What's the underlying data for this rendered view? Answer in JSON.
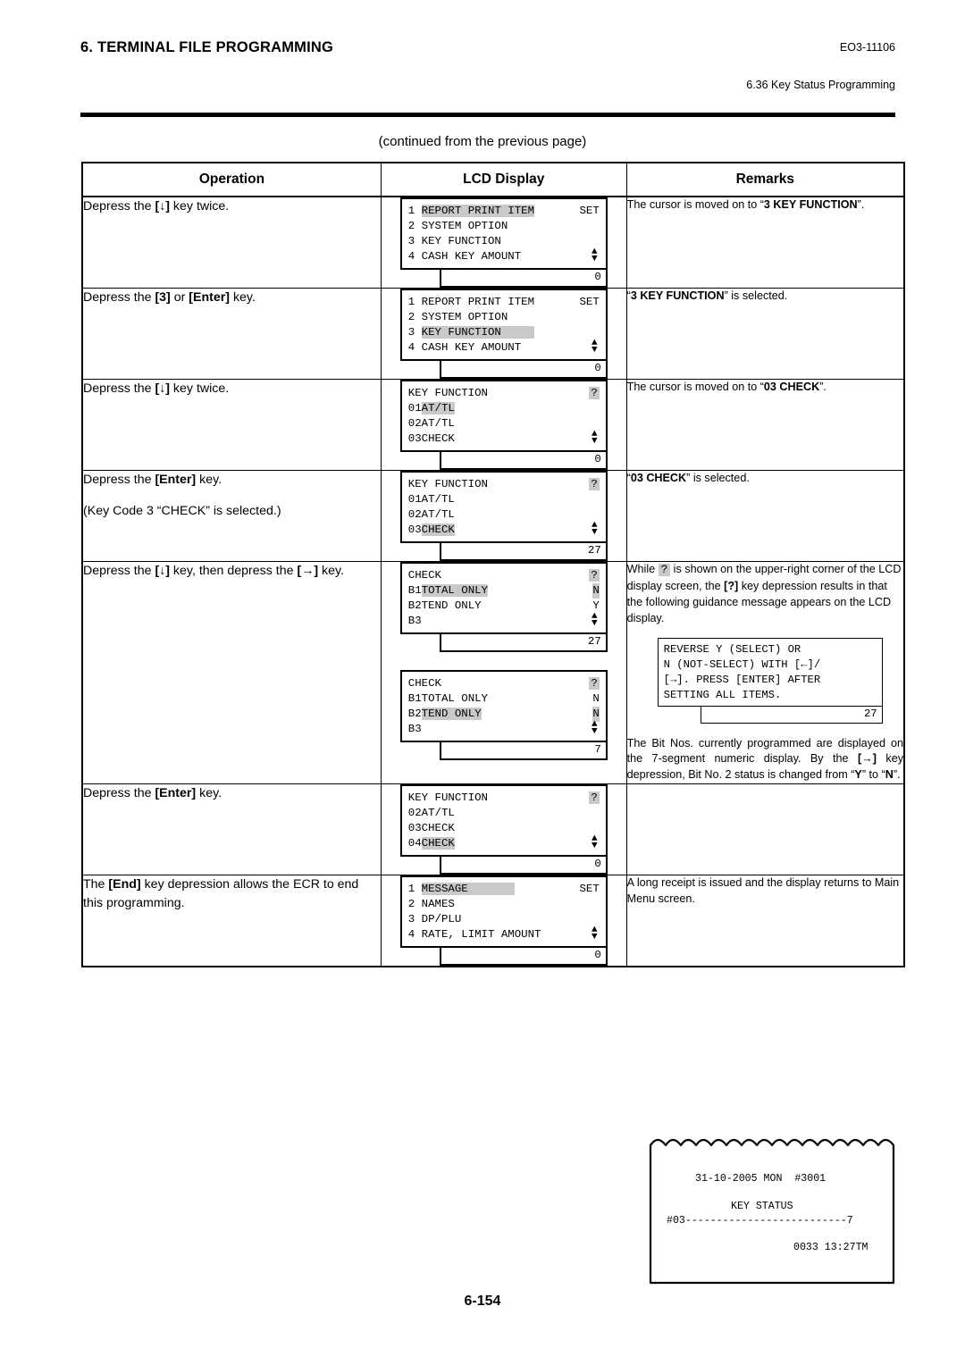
{
  "header": {
    "title": "6. TERMINAL FILE PROGRAMMING",
    "doc_code": "EO3-11106",
    "section": "6.36 Key Status Programming"
  },
  "continued_note": "(continued from the previous page)",
  "table": {
    "columns": [
      "Operation",
      "LCD Display",
      "Remarks"
    ],
    "rows": [
      {
        "operation_lines": [
          "Depress the [↓] key twice."
        ],
        "displays": [
          {
            "lines": [
              {
                "prefix": "1 ",
                "text": "REPORT PRINT ITEM",
                "highlight": true,
                "right": "SET"
              },
              {
                "prefix": "2 ",
                "text": "SYSTEM OPTION",
                "highlight": false
              },
              {
                "prefix": "3 ",
                "text": "KEY FUNCTION",
                "highlight": false
              },
              {
                "prefix": "4 ",
                "text": "CASH KEY AMOUNT",
                "highlight": false,
                "arrows": true
              }
            ],
            "numeric": "0"
          }
        ],
        "remarks": [
          "The cursor is moved on to “3 KEY FUNCTION”."
        ]
      },
      {
        "operation_lines": [
          "Depress the [3] or [Enter] key."
        ],
        "displays": [
          {
            "lines": [
              {
                "prefix": "1 ",
                "text": "REPORT PRINT ITEM",
                "highlight": false,
                "right": "SET"
              },
              {
                "prefix": "2 ",
                "text": "SYSTEM OPTION",
                "highlight": false
              },
              {
                "prefix": "3 ",
                "text": "KEY FUNCTION     ",
                "highlight": true
              },
              {
                "prefix": "4 ",
                "text": "CASH KEY AMOUNT",
                "highlight": false,
                "arrows": true
              }
            ],
            "numeric": "0"
          }
        ],
        "remarks": [
          "“3 KEY FUNCTION” is selected."
        ]
      },
      {
        "operation_lines": [
          "Depress the [↓] key twice."
        ],
        "displays": [
          {
            "lines": [
              {
                "prefix": "",
                "text": "KEY FUNCTION",
                "highlight": false,
                "question": true
              },
              {
                "prefix": "01",
                "text": "AT/TL",
                "highlight": true
              },
              {
                "prefix": "02",
                "text": "AT/TL",
                "highlight": false
              },
              {
                "prefix": "03",
                "text": "CHECK",
                "highlight": false,
                "arrows": true
              }
            ],
            "numeric": "0"
          }
        ],
        "remarks": [
          "The cursor is moved on to “03 CHECK”."
        ]
      },
      {
        "operation_lines": [
          "Depress the [Enter] key.",
          "(Key Code 3 “CHECK” is selected.)"
        ],
        "displays": [
          {
            "lines": [
              {
                "prefix": "",
                "text": "KEY FUNCTION",
                "highlight": false,
                "question": true
              },
              {
                "prefix": "01",
                "text": "AT/TL",
                "highlight": false
              },
              {
                "prefix": "02",
                "text": "AT/TL",
                "highlight": false
              },
              {
                "prefix": "03",
                "text": "CHECK",
                "highlight": true,
                "arrows": true
              }
            ],
            "numeric": "27"
          }
        ],
        "remarks": [
          "“03 CHECK” is selected."
        ]
      },
      {
        "operation_lines": [
          "Depress the [↓] key, then depress the [→] key."
        ],
        "displays": [
          {
            "lines": [
              {
                "prefix": "",
                "text": "CHECK",
                "highlight": false,
                "question": true
              },
              {
                "prefix": "B1",
                "text": "TOTAL ONLY",
                "highlight": true,
                "right": "N",
                "right_highlight": true
              },
              {
                "prefix": "B2",
                "text": "TEND ONLY",
                "highlight": false,
                "right": "Y"
              },
              {
                "prefix": "B3",
                "text": "",
                "highlight": false,
                "arrows": true
              }
            ],
            "numeric": "27"
          },
          {
            "lines": [
              {
                "prefix": "",
                "text": "CHECK",
                "highlight": false,
                "question": true
              },
              {
                "prefix": "B1",
                "text": "TOTAL ONLY",
                "highlight": false,
                "right": "N"
              },
              {
                "prefix": "B2",
                "text": "TEND ONLY",
                "highlight": true,
                "right": "N",
                "right_highlight": true
              },
              {
                "prefix": "B3",
                "text": "",
                "highlight": false,
                "arrows": true
              }
            ],
            "numeric": "7"
          }
        ],
        "remarks_rich": {
          "para1_a": "While",
          "para1_q": "?",
          "para1_b": "is shown on the upper-right corner of the LCD display screen, the",
          "para1_key": "[?]",
          "para1_c": "key depression results in that the following guidance message appears on the LCD display.",
          "guidance": {
            "lines": [
              "REVERSE Y (SELECT) OR",
              "N (NOT-SELECT) WITH [←]/",
              "[→]. PRESS [ENTER] AFTER",
              "SETTING ALL ITEMS."
            ],
            "numeric": "27"
          },
          "para2_a": "The Bit Nos. currently programmed are displayed on the 7-segment numeric display. By the",
          "para2_key": "[→]",
          "para2_b": "key depression, Bit No. 2 status is changed from “Y” to “N”."
        }
      },
      {
        "operation_lines": [
          "Depress the [Enter] key."
        ],
        "displays": [
          {
            "lines": [
              {
                "prefix": "",
                "text": "KEY FUNCTION",
                "highlight": false,
                "question": true
              },
              {
                "prefix": "02",
                "text": "AT/TL",
                "highlight": false
              },
              {
                "prefix": "03",
                "text": "CHECK",
                "highlight": false
              },
              {
                "prefix": "04",
                "text": "CHECK",
                "highlight": true,
                "arrows": true
              }
            ],
            "numeric": "0"
          }
        ],
        "remarks": []
      },
      {
        "operation_lines": [
          "The [End] key depression allows the ECR to end this programming."
        ],
        "displays": [
          {
            "lines": [
              {
                "prefix": "1 ",
                "text": "MESSAGE       ",
                "highlight": true,
                "right": "SET"
              },
              {
                "prefix": "2 ",
                "text": "NAMES",
                "highlight": false
              },
              {
                "prefix": "3 ",
                "text": "DP/PLU",
                "highlight": false
              },
              {
                "prefix": "4 ",
                "text": "RATE, LIMIT AMOUNT",
                "highlight": false,
                "arrows": true
              }
            ],
            "numeric": "0"
          }
        ],
        "remarks": [
          "A long receipt is issued and the display returns to Main Menu screen."
        ]
      }
    ]
  },
  "receipt": {
    "date_line": "31-10-2005 MON  #3001",
    "title": "KEY STATUS",
    "status_line": "#03--------------------------7",
    "footer": "0033 13:27TM"
  },
  "page_number": "6-154"
}
